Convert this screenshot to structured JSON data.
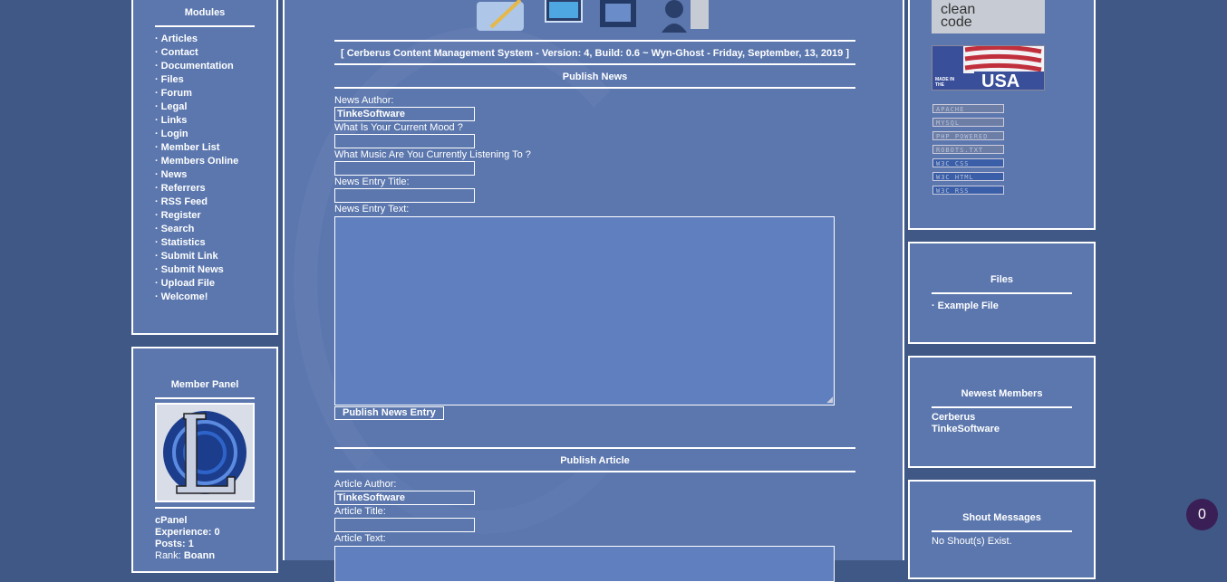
{
  "modules": {
    "title": "Modules",
    "items": [
      "Articles",
      "Contact",
      "Documentation",
      "Files",
      "Forum",
      "Legal",
      "Links",
      "Login",
      "Member List",
      "Members Online",
      "News",
      "Referrers",
      "RSS Feed",
      "Register",
      "Search",
      "Statistics",
      "Submit Link",
      "Submit News",
      "Upload File",
      "Welcome!"
    ]
  },
  "member_panel": {
    "title": "Member Panel",
    "cpanel": "cPanel",
    "experience_label": "Experience:",
    "experience_value": "0",
    "posts_label": "Posts:",
    "posts_value": "1",
    "rank_label": "Rank:",
    "rank_value": "Boann"
  },
  "header": {
    "version_line": "[ Cerberus Content Management System - Version: 4, Build: 0.6 ~ Wyn-Ghost - Friday, September, 13, 2019 ]"
  },
  "publish_news": {
    "title": "Publish News",
    "author_label": "News Author:",
    "author_value": "TinkeSoftware",
    "mood_label": "What Is Your Current Mood ?",
    "mood_value": "",
    "music_label": "What Music Are You Currently Listening To ?",
    "music_value": "",
    "entry_title_label": "News Entry Title:",
    "entry_title_value": "",
    "entry_text_label": "News Entry Text:",
    "submit_label": "Publish News Entry"
  },
  "publish_article": {
    "title": "Publish Article",
    "author_label": "Article Author:",
    "author_value": "TinkeSoftware",
    "title_label": "Article Title:",
    "title_value": "",
    "text_label": "Article Text:"
  },
  "logos": {
    "clean_code": "clean code",
    "made_in": "MADE IN THE",
    "usa": "USA"
  },
  "badges": [
    {
      "text": "APACHE",
      "color": "#b8c0d8"
    },
    {
      "text": "MYSQL",
      "color": "#b8c0d8"
    },
    {
      "text": "PHP POWERED",
      "color": "#b8c0d8"
    },
    {
      "text": "ROBOTS.TXT",
      "color": "#b8c0d8"
    },
    {
      "text": "W3C CSS",
      "color": "#b8c0d8"
    },
    {
      "text": "W3C HTML",
      "color": "#b8c0d8"
    },
    {
      "text": "W3C RSS",
      "color": "#b8c0d8"
    }
  ],
  "files_panel": {
    "title": "Files",
    "items": [
      "Example File"
    ]
  },
  "newest_members": {
    "title": "Newest Members",
    "items": [
      "Cerberus",
      "TinkeSoftware"
    ]
  },
  "shout_messages": {
    "title": "Shout Messages",
    "empty_text": "No Shout(s) Exist."
  },
  "notification_count": "0"
}
